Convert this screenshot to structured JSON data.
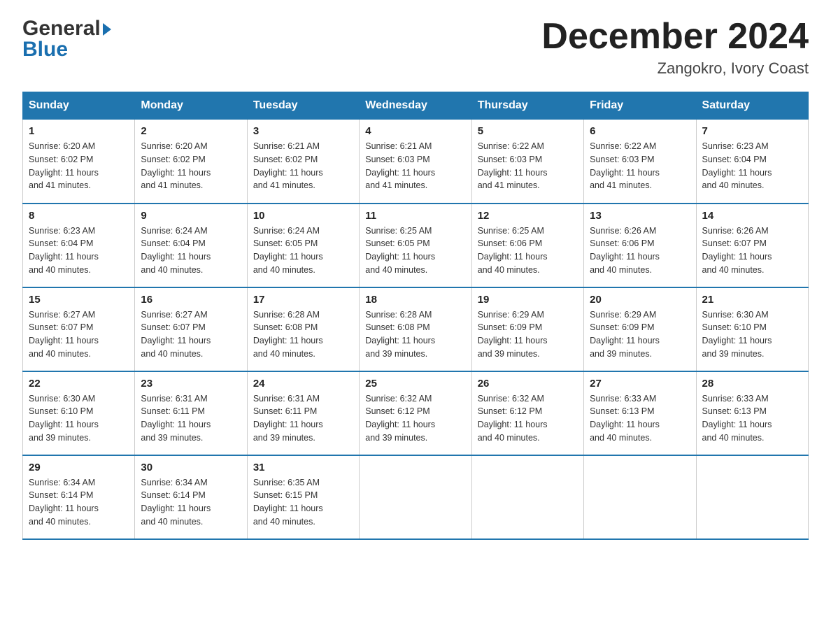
{
  "header": {
    "logo_general": "General",
    "logo_blue": "Blue",
    "month_title": "December 2024",
    "location": "Zangokro, Ivory Coast"
  },
  "days_of_week": [
    "Sunday",
    "Monday",
    "Tuesday",
    "Wednesday",
    "Thursday",
    "Friday",
    "Saturday"
  ],
  "weeks": [
    [
      {
        "day": "1",
        "sunrise": "6:20 AM",
        "sunset": "6:02 PM",
        "daylight": "11 hours and 41 minutes."
      },
      {
        "day": "2",
        "sunrise": "6:20 AM",
        "sunset": "6:02 PM",
        "daylight": "11 hours and 41 minutes."
      },
      {
        "day": "3",
        "sunrise": "6:21 AM",
        "sunset": "6:02 PM",
        "daylight": "11 hours and 41 minutes."
      },
      {
        "day": "4",
        "sunrise": "6:21 AM",
        "sunset": "6:03 PM",
        "daylight": "11 hours and 41 minutes."
      },
      {
        "day": "5",
        "sunrise": "6:22 AM",
        "sunset": "6:03 PM",
        "daylight": "11 hours and 41 minutes."
      },
      {
        "day": "6",
        "sunrise": "6:22 AM",
        "sunset": "6:03 PM",
        "daylight": "11 hours and 41 minutes."
      },
      {
        "day": "7",
        "sunrise": "6:23 AM",
        "sunset": "6:04 PM",
        "daylight": "11 hours and 40 minutes."
      }
    ],
    [
      {
        "day": "8",
        "sunrise": "6:23 AM",
        "sunset": "6:04 PM",
        "daylight": "11 hours and 40 minutes."
      },
      {
        "day": "9",
        "sunrise": "6:24 AM",
        "sunset": "6:04 PM",
        "daylight": "11 hours and 40 minutes."
      },
      {
        "day": "10",
        "sunrise": "6:24 AM",
        "sunset": "6:05 PM",
        "daylight": "11 hours and 40 minutes."
      },
      {
        "day": "11",
        "sunrise": "6:25 AM",
        "sunset": "6:05 PM",
        "daylight": "11 hours and 40 minutes."
      },
      {
        "day": "12",
        "sunrise": "6:25 AM",
        "sunset": "6:06 PM",
        "daylight": "11 hours and 40 minutes."
      },
      {
        "day": "13",
        "sunrise": "6:26 AM",
        "sunset": "6:06 PM",
        "daylight": "11 hours and 40 minutes."
      },
      {
        "day": "14",
        "sunrise": "6:26 AM",
        "sunset": "6:07 PM",
        "daylight": "11 hours and 40 minutes."
      }
    ],
    [
      {
        "day": "15",
        "sunrise": "6:27 AM",
        "sunset": "6:07 PM",
        "daylight": "11 hours and 40 minutes."
      },
      {
        "day": "16",
        "sunrise": "6:27 AM",
        "sunset": "6:07 PM",
        "daylight": "11 hours and 40 minutes."
      },
      {
        "day": "17",
        "sunrise": "6:28 AM",
        "sunset": "6:08 PM",
        "daylight": "11 hours and 40 minutes."
      },
      {
        "day": "18",
        "sunrise": "6:28 AM",
        "sunset": "6:08 PM",
        "daylight": "11 hours and 39 minutes."
      },
      {
        "day": "19",
        "sunrise": "6:29 AM",
        "sunset": "6:09 PM",
        "daylight": "11 hours and 39 minutes."
      },
      {
        "day": "20",
        "sunrise": "6:29 AM",
        "sunset": "6:09 PM",
        "daylight": "11 hours and 39 minutes."
      },
      {
        "day": "21",
        "sunrise": "6:30 AM",
        "sunset": "6:10 PM",
        "daylight": "11 hours and 39 minutes."
      }
    ],
    [
      {
        "day": "22",
        "sunrise": "6:30 AM",
        "sunset": "6:10 PM",
        "daylight": "11 hours and 39 minutes."
      },
      {
        "day": "23",
        "sunrise": "6:31 AM",
        "sunset": "6:11 PM",
        "daylight": "11 hours and 39 minutes."
      },
      {
        "day": "24",
        "sunrise": "6:31 AM",
        "sunset": "6:11 PM",
        "daylight": "11 hours and 39 minutes."
      },
      {
        "day": "25",
        "sunrise": "6:32 AM",
        "sunset": "6:12 PM",
        "daylight": "11 hours and 39 minutes."
      },
      {
        "day": "26",
        "sunrise": "6:32 AM",
        "sunset": "6:12 PM",
        "daylight": "11 hours and 40 minutes."
      },
      {
        "day": "27",
        "sunrise": "6:33 AM",
        "sunset": "6:13 PM",
        "daylight": "11 hours and 40 minutes."
      },
      {
        "day": "28",
        "sunrise": "6:33 AM",
        "sunset": "6:13 PM",
        "daylight": "11 hours and 40 minutes."
      }
    ],
    [
      {
        "day": "29",
        "sunrise": "6:34 AM",
        "sunset": "6:14 PM",
        "daylight": "11 hours and 40 minutes."
      },
      {
        "day": "30",
        "sunrise": "6:34 AM",
        "sunset": "6:14 PM",
        "daylight": "11 hours and 40 minutes."
      },
      {
        "day": "31",
        "sunrise": "6:35 AM",
        "sunset": "6:15 PM",
        "daylight": "11 hours and 40 minutes."
      },
      null,
      null,
      null,
      null
    ]
  ],
  "labels": {
    "sunrise": "Sunrise:",
    "sunset": "Sunset:",
    "daylight": "Daylight:"
  }
}
